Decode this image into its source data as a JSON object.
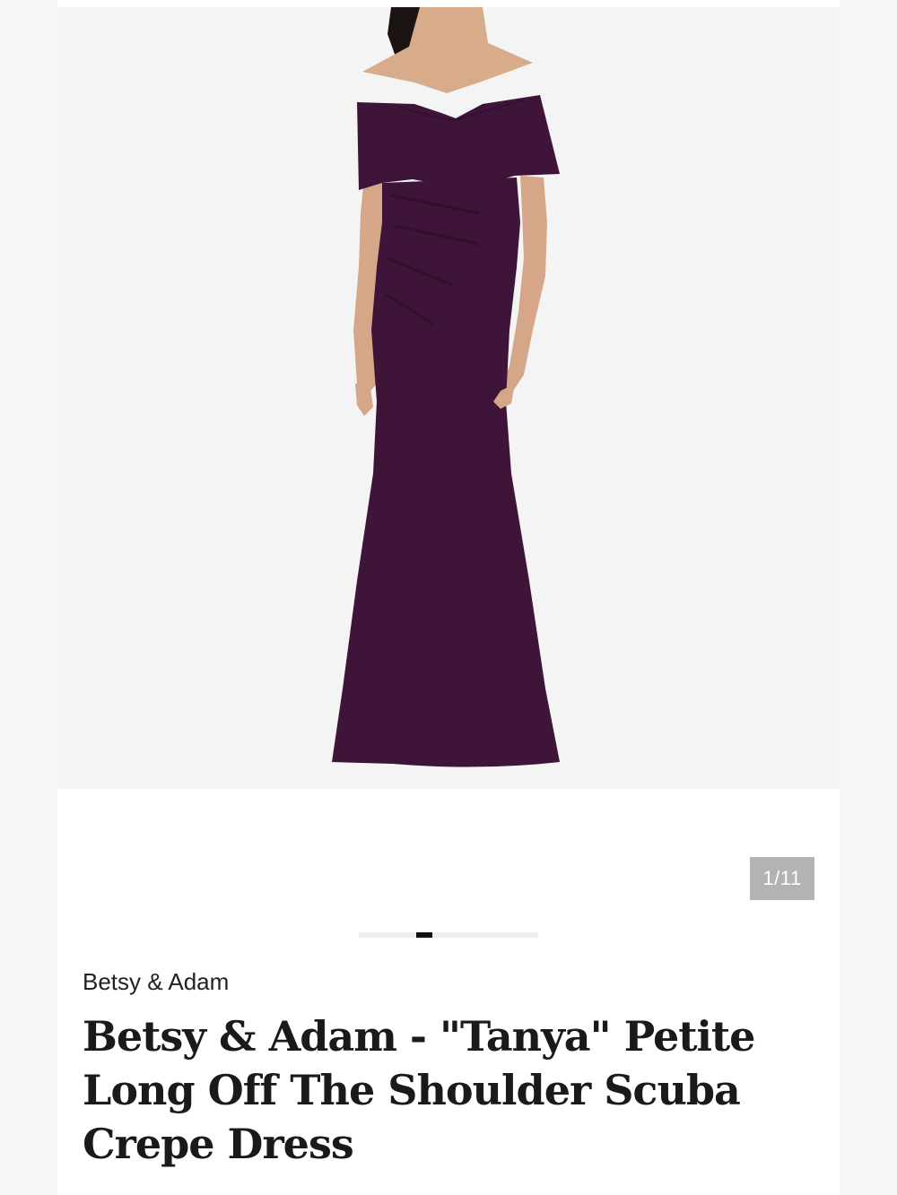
{
  "product": {
    "brand": "Betsy & Adam",
    "title": "Betsy & Adam - \"Tanya\" Petite Long Off The Shoulder Scuba Crepe Dress",
    "dress_color": "#3e1538"
  },
  "gallery": {
    "counter_text": "1/11",
    "current_index": 1,
    "total_images": 11,
    "progress_fraction": 0.0909
  },
  "colors": {
    "background": "#f7f7f7",
    "card": "#ffffff",
    "image_bg": "#f4f4f4",
    "counter_bg": "#b3b3b3",
    "progress_track": "#eeeeee",
    "progress_fill": "#111111",
    "title": "#1a1a1a"
  }
}
